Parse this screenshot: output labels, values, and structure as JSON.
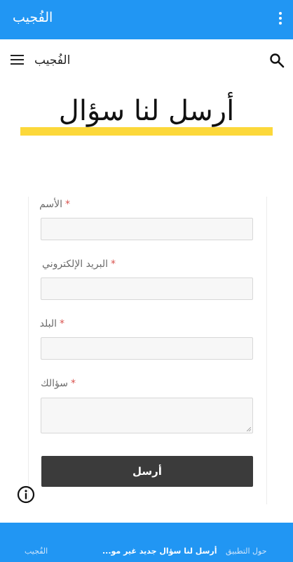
{
  "appbar": {
    "title": "الفُجيب"
  },
  "site": {
    "name": "الفُجيب"
  },
  "page": {
    "title": "أرسل لنا سؤال"
  },
  "form": {
    "fields": [
      {
        "label": "الأسم",
        "required_mark": "*",
        "value": ""
      },
      {
        "label": "البريد الإلكتروني",
        "required_mark": "*",
        "value": ""
      },
      {
        "label": "البلد",
        "required_mark": "*",
        "value": ""
      },
      {
        "label": "سؤالك",
        "required_mark": "*",
        "value": ""
      }
    ],
    "submit_label": "أرسل"
  },
  "bottom_nav": {
    "items": [
      {
        "label": "الفُجيب"
      },
      {
        "label": "أرسل لنا سؤال جديد غير مو..."
      },
      {
        "label": "حول التطبيق"
      }
    ]
  },
  "colors": {
    "primary": "#2196f3",
    "accent_underline": "#fcd83a",
    "button": "#3b3b3b",
    "required": "#d9534f"
  }
}
